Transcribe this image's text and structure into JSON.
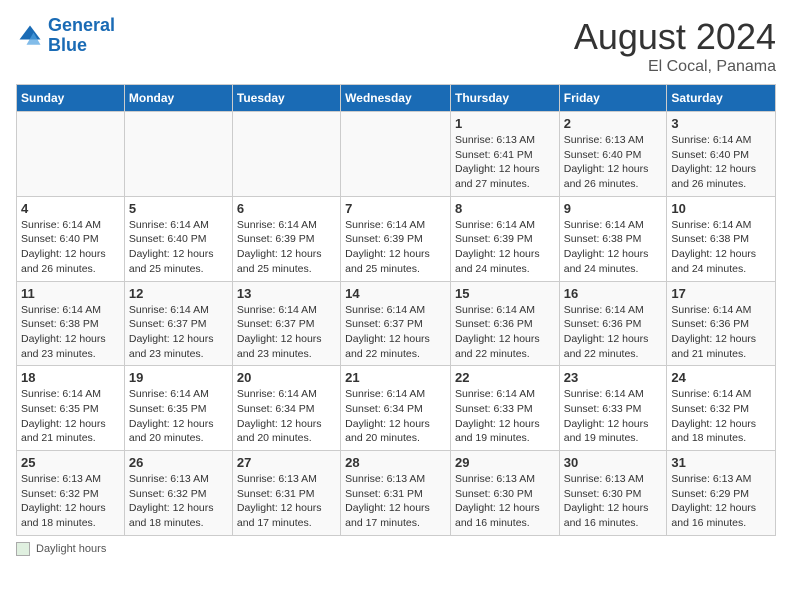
{
  "header": {
    "logo_general": "General",
    "logo_blue": "Blue",
    "month_year": "August 2024",
    "location": "El Cocal, Panama"
  },
  "days_of_week": [
    "Sunday",
    "Monday",
    "Tuesday",
    "Wednesday",
    "Thursday",
    "Friday",
    "Saturday"
  ],
  "footer": {
    "label": "Daylight hours"
  },
  "weeks": [
    {
      "days": [
        {
          "num": "",
          "info": ""
        },
        {
          "num": "",
          "info": ""
        },
        {
          "num": "",
          "info": ""
        },
        {
          "num": "",
          "info": ""
        },
        {
          "num": "1",
          "info": "Sunrise: 6:13 AM\nSunset: 6:41 PM\nDaylight: 12 hours and 27 minutes."
        },
        {
          "num": "2",
          "info": "Sunrise: 6:13 AM\nSunset: 6:40 PM\nDaylight: 12 hours and 26 minutes."
        },
        {
          "num": "3",
          "info": "Sunrise: 6:14 AM\nSunset: 6:40 PM\nDaylight: 12 hours and 26 minutes."
        }
      ]
    },
    {
      "days": [
        {
          "num": "4",
          "info": "Sunrise: 6:14 AM\nSunset: 6:40 PM\nDaylight: 12 hours and 26 minutes."
        },
        {
          "num": "5",
          "info": "Sunrise: 6:14 AM\nSunset: 6:40 PM\nDaylight: 12 hours and 25 minutes."
        },
        {
          "num": "6",
          "info": "Sunrise: 6:14 AM\nSunset: 6:39 PM\nDaylight: 12 hours and 25 minutes."
        },
        {
          "num": "7",
          "info": "Sunrise: 6:14 AM\nSunset: 6:39 PM\nDaylight: 12 hours and 25 minutes."
        },
        {
          "num": "8",
          "info": "Sunrise: 6:14 AM\nSunset: 6:39 PM\nDaylight: 12 hours and 24 minutes."
        },
        {
          "num": "9",
          "info": "Sunrise: 6:14 AM\nSunset: 6:38 PM\nDaylight: 12 hours and 24 minutes."
        },
        {
          "num": "10",
          "info": "Sunrise: 6:14 AM\nSunset: 6:38 PM\nDaylight: 12 hours and 24 minutes."
        }
      ]
    },
    {
      "days": [
        {
          "num": "11",
          "info": "Sunrise: 6:14 AM\nSunset: 6:38 PM\nDaylight: 12 hours and 23 minutes."
        },
        {
          "num": "12",
          "info": "Sunrise: 6:14 AM\nSunset: 6:37 PM\nDaylight: 12 hours and 23 minutes."
        },
        {
          "num": "13",
          "info": "Sunrise: 6:14 AM\nSunset: 6:37 PM\nDaylight: 12 hours and 23 minutes."
        },
        {
          "num": "14",
          "info": "Sunrise: 6:14 AM\nSunset: 6:37 PM\nDaylight: 12 hours and 22 minutes."
        },
        {
          "num": "15",
          "info": "Sunrise: 6:14 AM\nSunset: 6:36 PM\nDaylight: 12 hours and 22 minutes."
        },
        {
          "num": "16",
          "info": "Sunrise: 6:14 AM\nSunset: 6:36 PM\nDaylight: 12 hours and 22 minutes."
        },
        {
          "num": "17",
          "info": "Sunrise: 6:14 AM\nSunset: 6:36 PM\nDaylight: 12 hours and 21 minutes."
        }
      ]
    },
    {
      "days": [
        {
          "num": "18",
          "info": "Sunrise: 6:14 AM\nSunset: 6:35 PM\nDaylight: 12 hours and 21 minutes."
        },
        {
          "num": "19",
          "info": "Sunrise: 6:14 AM\nSunset: 6:35 PM\nDaylight: 12 hours and 20 minutes."
        },
        {
          "num": "20",
          "info": "Sunrise: 6:14 AM\nSunset: 6:34 PM\nDaylight: 12 hours and 20 minutes."
        },
        {
          "num": "21",
          "info": "Sunrise: 6:14 AM\nSunset: 6:34 PM\nDaylight: 12 hours and 20 minutes."
        },
        {
          "num": "22",
          "info": "Sunrise: 6:14 AM\nSunset: 6:33 PM\nDaylight: 12 hours and 19 minutes."
        },
        {
          "num": "23",
          "info": "Sunrise: 6:14 AM\nSunset: 6:33 PM\nDaylight: 12 hours and 19 minutes."
        },
        {
          "num": "24",
          "info": "Sunrise: 6:14 AM\nSunset: 6:32 PM\nDaylight: 12 hours and 18 minutes."
        }
      ]
    },
    {
      "days": [
        {
          "num": "25",
          "info": "Sunrise: 6:13 AM\nSunset: 6:32 PM\nDaylight: 12 hours and 18 minutes."
        },
        {
          "num": "26",
          "info": "Sunrise: 6:13 AM\nSunset: 6:32 PM\nDaylight: 12 hours and 18 minutes."
        },
        {
          "num": "27",
          "info": "Sunrise: 6:13 AM\nSunset: 6:31 PM\nDaylight: 12 hours and 17 minutes."
        },
        {
          "num": "28",
          "info": "Sunrise: 6:13 AM\nSunset: 6:31 PM\nDaylight: 12 hours and 17 minutes."
        },
        {
          "num": "29",
          "info": "Sunrise: 6:13 AM\nSunset: 6:30 PM\nDaylight: 12 hours and 16 minutes."
        },
        {
          "num": "30",
          "info": "Sunrise: 6:13 AM\nSunset: 6:30 PM\nDaylight: 12 hours and 16 minutes."
        },
        {
          "num": "31",
          "info": "Sunrise: 6:13 AM\nSunset: 6:29 PM\nDaylight: 12 hours and 16 minutes."
        }
      ]
    }
  ]
}
